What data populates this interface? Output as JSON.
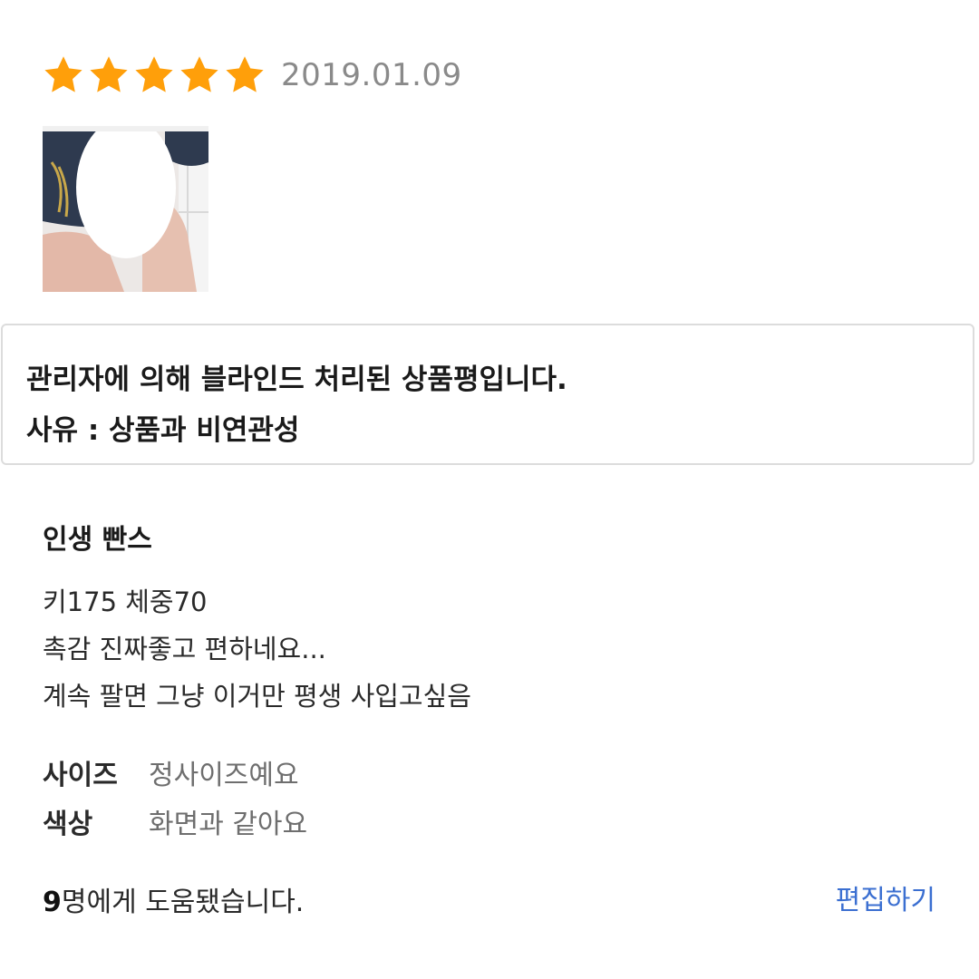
{
  "review": {
    "rating": 5,
    "rating_max": 5,
    "star_color": "#FF9F0A",
    "date": "2019.01.09",
    "photo_icon": "product-photo-thumbnail",
    "blind_notice": {
      "line1": "관리자에 의해 블라인드 처리된 상품평입니다.",
      "line2": "사유 : 상품과 비연관성"
    },
    "title": "인생 빤스",
    "body_lines": [
      "키175 체중70",
      "촉감 진짜좋고 편하네요...",
      "계속 팔면 그냥 이거만 평생 사입고싶음"
    ],
    "attributes": {
      "size_label": "사이즈",
      "size_value": "정사이즈예요",
      "color_label": "색상",
      "color_value": "화면과 같아요"
    },
    "helpful": {
      "count": "9",
      "text": "명에게 도움됐습니다."
    },
    "edit_label": "편집하기",
    "link_color": "#3B6FD1"
  }
}
